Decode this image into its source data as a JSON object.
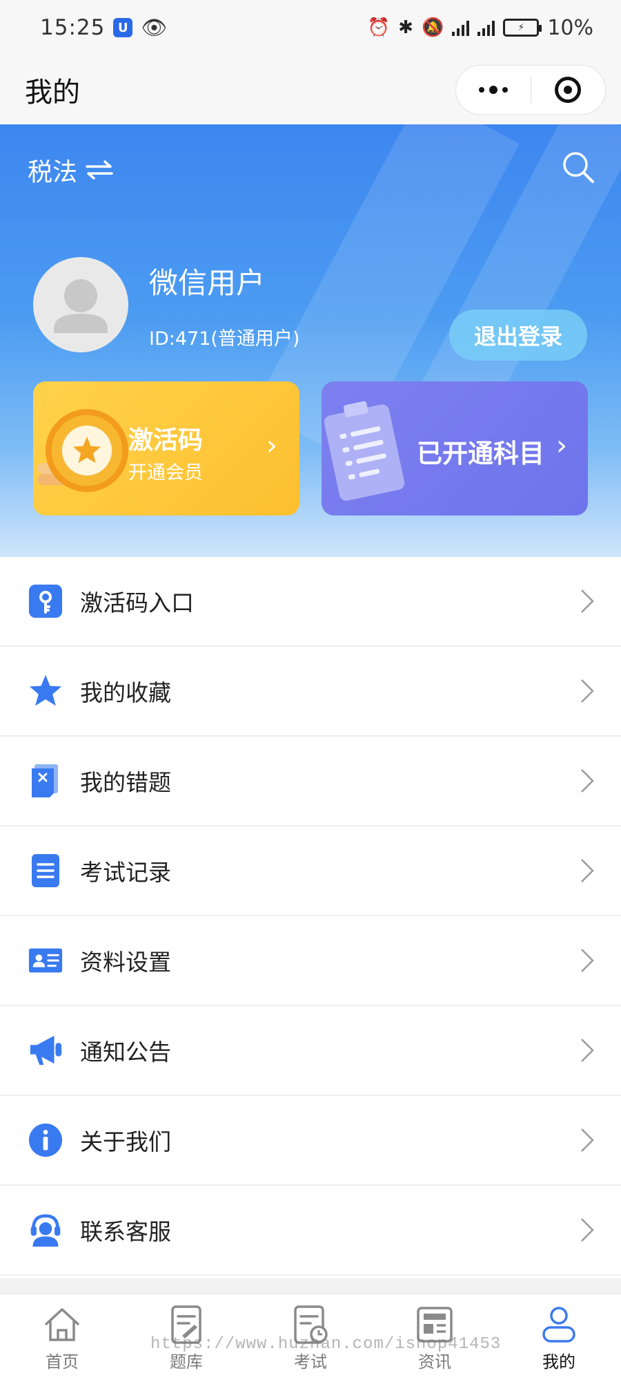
{
  "status_bar": {
    "time": "15:25",
    "battery": "10%",
    "network": "4G"
  },
  "title_bar": {
    "title": "我的",
    "menu_icon": "more-dots-icon",
    "close_icon": "target-circle-icon"
  },
  "header": {
    "subject": "税法",
    "swap_icon": "swap-arrows-icon",
    "search_icon": "search-icon",
    "user_name": "微信用户",
    "user_id": "ID:471(普通用户)",
    "logout_label": "退出登录",
    "activation_card": {
      "title": "激活码",
      "subtitle": "开通会员",
      "arrow": "›"
    },
    "subjects_card": {
      "title": "已开通科目",
      "arrow": "›"
    }
  },
  "menu": {
    "items": [
      {
        "label": "激活码入口",
        "icon": "key-icon"
      },
      {
        "label": "我的收藏",
        "icon": "star-icon"
      },
      {
        "label": "我的错题",
        "icon": "wrong-note-icon"
      },
      {
        "label": "考试记录",
        "icon": "document-list-icon"
      },
      {
        "label": "资料设置",
        "icon": "id-card-icon"
      },
      {
        "label": "通知公告",
        "icon": "megaphone-icon"
      },
      {
        "label": "关于我们",
        "icon": "info-icon"
      },
      {
        "label": "联系客服",
        "icon": "headset-icon"
      }
    ]
  },
  "tab_bar": {
    "tabs": [
      {
        "label": "首页",
        "icon": "home-icon",
        "active": false
      },
      {
        "label": "题库",
        "icon": "question-bank-icon",
        "active": false
      },
      {
        "label": "考试",
        "icon": "exam-icon",
        "active": false
      },
      {
        "label": "资讯",
        "icon": "news-icon",
        "active": false
      },
      {
        "label": "我的",
        "icon": "profile-icon",
        "active": true
      }
    ]
  },
  "watermark": "https://www.huzhan.com/ishop41453",
  "colors": {
    "accent": "#3a7af0",
    "activation_card": "#fdc53a",
    "subjects_card": "#7277ed"
  }
}
